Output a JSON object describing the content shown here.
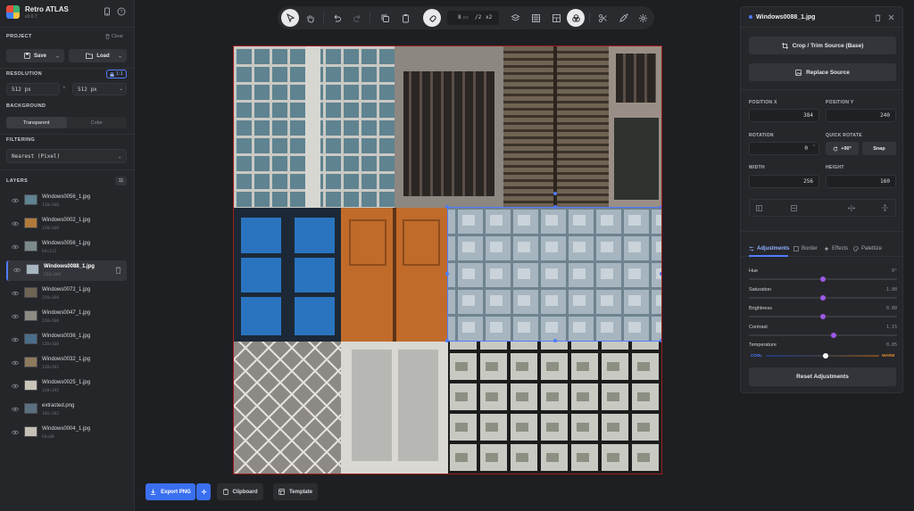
{
  "app": {
    "title": "Retro ATLAS",
    "version": "v0.0.7"
  },
  "project": {
    "section": "PROJECT",
    "clear": "Clear",
    "save": "Save",
    "load": "Load"
  },
  "resolution": {
    "section": "RESOLUTION",
    "badge": "1:1",
    "width": "512 px",
    "times": "×",
    "height": "512 px"
  },
  "background": {
    "section": "BACKGROUND",
    "options": [
      "Transparent",
      "Color"
    ],
    "selected": "Transparent"
  },
  "filtering": {
    "section": "FILTERING",
    "value": "Nearest (Pixel)"
  },
  "layers": {
    "section": "LAYERS",
    "count": "11",
    "items": [
      {
        "name": "Windows0056_1.jpg",
        "size": "128×160"
      },
      {
        "name": "Windows0002_1.jpg",
        "size": "128×160"
      },
      {
        "name": "Windows0056_1.jpg",
        "size": "64×112"
      },
      {
        "name": "Windows0088_1.jpg",
        "size": "256×160",
        "selected": true
      },
      {
        "name": "Windows0072_1.jpg",
        "size": "256×160"
      },
      {
        "name": "Windows0047_1.jpg",
        "size": "128×160"
      },
      {
        "name": "Windows0036_1.jpg",
        "size": "128×160"
      },
      {
        "name": "Windows0032_1.jpg",
        "size": "128×192"
      },
      {
        "name": "Windows0025_1.jpg",
        "size": "128×192"
      },
      {
        "name": "extracted.png",
        "size": "192×192"
      },
      {
        "name": "Windows0004_1.jpg",
        "size": "64×80"
      }
    ]
  },
  "toolbar": {
    "grid_value": "8",
    "grid_unit": "px",
    "div": "/2",
    "mul": "x2"
  },
  "bottom": {
    "export": "Export PNG",
    "clipboard": "Clipboard",
    "template": "Template"
  },
  "panel": {
    "title": "Windows0088_1.jpg",
    "crop_button": "Crop / Trim Source (Base)",
    "replace_button": "Replace Source",
    "pos_x_label": "POSITION X",
    "pos_x": "384",
    "pos_y_label": "POSITION Y",
    "pos_y": "240",
    "rotation_label": "ROTATION",
    "rotation": "0",
    "rotation_unit": "°",
    "quick_rotate_label": "QUICK ROTATE",
    "rotate_btn": "+90°",
    "snap_btn": "Snap",
    "width_label": "WIDTH",
    "width": "256",
    "height_label": "HEIGHT",
    "height": "160",
    "tabs": [
      "Adjustments",
      "Border",
      "Effects",
      "Palettize"
    ],
    "active_tab": "Adjustments",
    "adjustments": [
      {
        "label": "Hue",
        "value": "0°",
        "level": 0.5
      },
      {
        "label": "Saturation",
        "value": "1.00",
        "level": 0.5
      },
      {
        "label": "Brightness",
        "value": "0.00",
        "level": 0.5
      },
      {
        "label": "Contrast",
        "value": "1.15",
        "level": 0.575
      }
    ],
    "temperature": {
      "label": "Temperature",
      "value": "0.05",
      "cool": "COOL",
      "warm": "WARM",
      "level": 0.525
    },
    "reset": "Reset Adjustments"
  },
  "colors": {
    "accent": "#4f7cff",
    "slider": "#9b59e6",
    "canvas_border": "#a11d1d",
    "cool": "#4f7cff",
    "warm": "#e08a2e"
  }
}
